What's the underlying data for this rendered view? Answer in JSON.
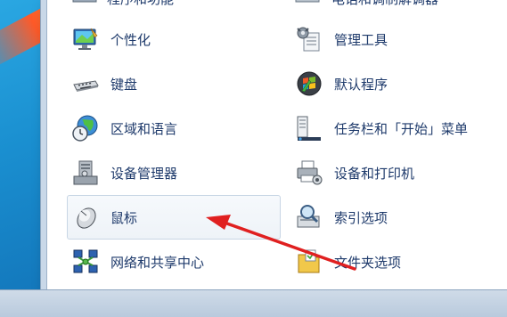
{
  "control_panel": {
    "top_cut": {
      "left_label": "程序和功能",
      "right_label": "电话和调制解调器"
    },
    "items_left": [
      {
        "label": "个性化",
        "icon": "personalization-icon"
      },
      {
        "label": "键盘",
        "icon": "keyboard-icon"
      },
      {
        "label": "区域和语言",
        "icon": "globe-clock-icon"
      },
      {
        "label": "设备管理器",
        "icon": "device-manager-icon"
      },
      {
        "label": "鼠标",
        "icon": "mouse-icon",
        "selected": true
      },
      {
        "label": "网络和共享中心",
        "icon": "network-icon"
      }
    ],
    "items_right": [
      {
        "label": "管理工具",
        "icon": "admin-tools-icon"
      },
      {
        "label": "默认程序",
        "icon": "default-programs-icon"
      },
      {
        "label": "任务栏和「开始」菜单",
        "icon": "taskbar-icon"
      },
      {
        "label": "设备和打印机",
        "icon": "printer-icon"
      },
      {
        "label": "索引选项",
        "icon": "indexing-icon"
      },
      {
        "label": "文件夹选项",
        "icon": "folder-options-icon"
      }
    ]
  },
  "annotation": {
    "arrow_color": "#e02020",
    "target": "鼠标"
  }
}
